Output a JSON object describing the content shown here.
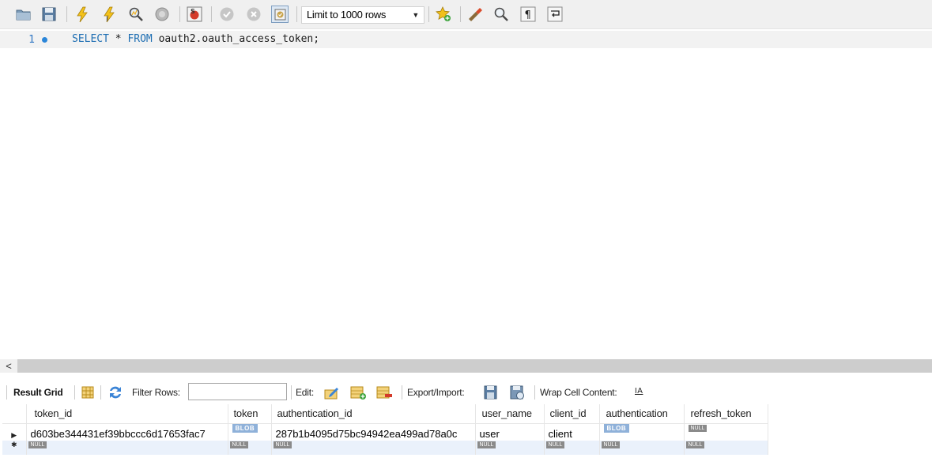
{
  "toolbar": {
    "limit_select": "Limit to 1000 rows",
    "icons": [
      "open-folder-icon",
      "save-icon",
      "execute-icon",
      "execute-current-icon",
      "explain-icon",
      "stop-icon",
      "toggle-error-icon",
      "commit-icon",
      "rollback-icon",
      "autocommit-icon",
      "add-snippet-icon",
      "beautify-icon",
      "find-icon",
      "invisible-chars-icon",
      "wrap-lines-icon"
    ]
  },
  "editor": {
    "line_number": "1",
    "sql": {
      "kw1": "SELECT",
      "star": " * ",
      "kw2": "FROM",
      "rest": " oauth2.oauth_access_token;"
    }
  },
  "scroll": {
    "left_arrow": "<"
  },
  "result_toolbar": {
    "tab": "Result Grid",
    "filter_label": "Filter Rows:",
    "filter_value": "",
    "edit_label": "Edit:",
    "export_label": "Export/Import:",
    "wrap_label": "Wrap Cell Content:",
    "wrap_icon": "IA"
  },
  "table": {
    "columns": [
      "token_id",
      "token",
      "authentication_id",
      "user_name",
      "client_id",
      "authentication",
      "refresh_token"
    ],
    "row": {
      "marker": "▶",
      "token_id": "d603be344431ef39bbccc6d17653fac7",
      "token": "BLOB",
      "authentication_id": "287b1b4095d75bc94942ea499ad78a0c",
      "user_name": "user",
      "client_id": "client",
      "authentication": "BLOB",
      "refresh_token": "NULL"
    },
    "new_row": {
      "marker": "✱",
      "null_text": "NULL"
    }
  },
  "colors": {
    "keyword": "#1f6fb3",
    "blob": "#8fb1d9",
    "null": "#8a8a8a",
    "new_row": "#eaf1fb"
  }
}
